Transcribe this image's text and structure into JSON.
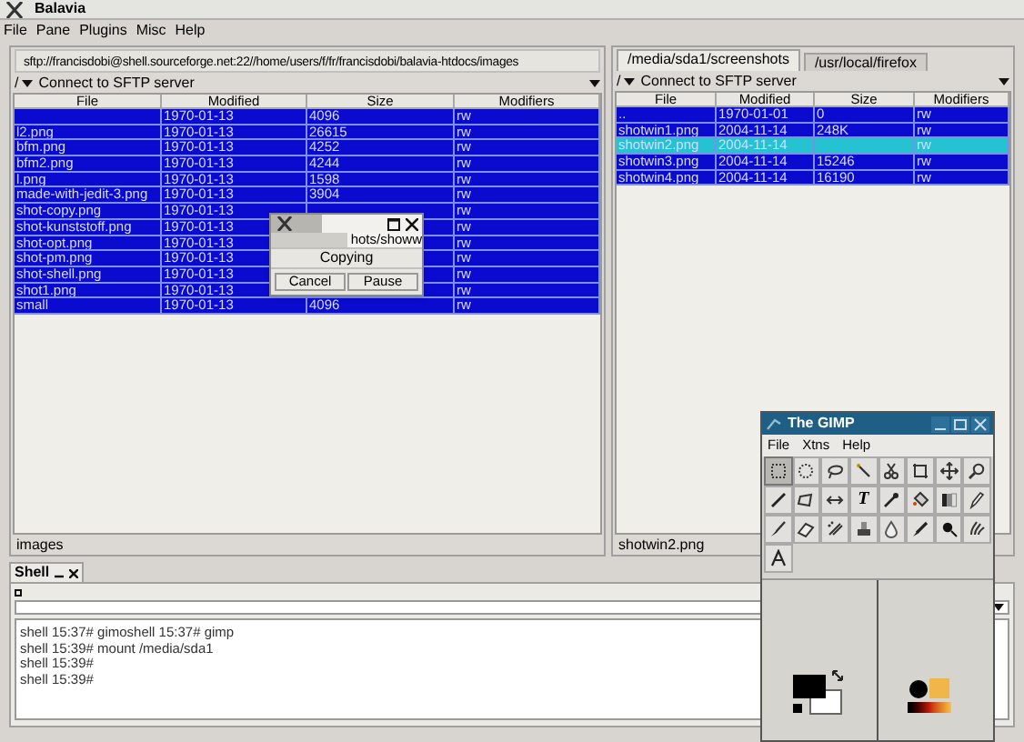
{
  "window": {
    "title": "Balavia"
  },
  "menu": [
    "File",
    "Pane",
    "Plugins",
    "Misc",
    "Help"
  ],
  "left_pane": {
    "path": "sftp://francisdobi@shell.sourceforge.net:22//home/users/f/fr/francisdobi/balavia-htdocs/images",
    "root": "/",
    "connection": "Connect to SFTP server",
    "columns": [
      "File",
      "Modified",
      "Size",
      "Modifiers"
    ],
    "rows": [
      {
        "modified": "1970-01-13",
        "size": "4096",
        "modifiers": "rw",
        "selected": true
      },
      {
        "file": "l2.png",
        "modified": "1970-01-13",
        "size": "26615",
        "modifiers": "rw",
        "selected": true
      },
      {
        "file": "bfm.png",
        "modified": "1970-01-13",
        "size": "4252",
        "modifiers": "rw",
        "selected": true
      },
      {
        "file": "bfm2.png",
        "modified": "1970-01-13",
        "size": "4244",
        "modifiers": "rw",
        "selected": true
      },
      {
        "file": "l.png",
        "modified": "1970-01-13",
        "size": "1598",
        "modifiers": "rw",
        "selected": true
      },
      {
        "file": "made-with-jedit-3.png",
        "modified": "1970-01-13",
        "size": "3904",
        "modifiers": "rw",
        "selected": true
      },
      {
        "file": "shot-copy.png",
        "modified": "1970-01-13",
        "modifiers": "rw",
        "selected": true
      },
      {
        "file": "shot-kunststoff.png",
        "modified": "1970-01-13",
        "modifiers": "rw",
        "selected": true
      },
      {
        "file": "shot-opt.png",
        "modified": "1970-01-13",
        "modifiers": "rw",
        "selected": true
      },
      {
        "file": "shot-pm.png",
        "modified": "1970-01-13",
        "modifiers": "rw",
        "selected": true
      },
      {
        "file": "shot-shell.png",
        "modified": "1970-01-13",
        "modifiers": "rw",
        "selected": true
      },
      {
        "file": "shot1.png",
        "modified": "1970-01-13",
        "modifiers": "rw",
        "selected": true
      },
      {
        "file": "small",
        "modified": "1970-01-13",
        "size": "4096",
        "modifiers": "rw",
        "selected": true
      }
    ],
    "status": "images"
  },
  "right_pane": {
    "tabs": [
      {
        "label": "/media/sda1/screenshots",
        "selected": true
      },
      {
        "label": "/usr/local/firefox",
        "selected": false
      }
    ],
    "root": "/",
    "connection": "Connect to SFTP server",
    "columns": [
      "File",
      "Modified",
      "Size",
      "Modifiers"
    ],
    "rows": [
      {
        "file": "..",
        "modified": "1970-01-01",
        "size": "0",
        "modifiers": "rw",
        "selected": true,
        "focused": false
      },
      {
        "file": "shotwin1.png",
        "modified": "2004-11-14",
        "size": "248K",
        "modifiers": "rw",
        "selected": true,
        "focused": false
      },
      {
        "file": "shotwin2.png",
        "modified": "2004-11-14",
        "modifiers": "rw",
        "selected": true,
        "focused": true
      },
      {
        "file": "shotwin3.png",
        "modified": "2004-11-14",
        "size": "15246",
        "modifiers": "rw",
        "selected": true,
        "focused": false
      },
      {
        "file": "shotwin4.png",
        "modified": "2004-11-14",
        "size": "16190",
        "modifiers": "rw",
        "selected": true,
        "focused": false
      }
    ],
    "status": "shotwin2.png"
  },
  "copy_dialog": {
    "field": "hots/showw",
    "label": "Copying",
    "buttons": [
      "Cancel",
      "Pause"
    ]
  },
  "shell": {
    "tab": "Shell",
    "lines": [
      "shell 15:37# gimoshell 15:37# gimp",
      "shell 15:39# mount /media/sda1",
      "shell 15:39#",
      "shell 15:39#"
    ]
  },
  "gimp": {
    "title": "The GIMP",
    "menu": [
      "File",
      "Xtns",
      "Help"
    ],
    "tools": [
      {
        "kind": "rect-select",
        "selected": true
      },
      {
        "kind": "ellipse-select",
        "selected": false
      },
      {
        "kind": "lasso",
        "selected": false
      },
      {
        "kind": "wand",
        "selected": false
      },
      {
        "kind": "scissors",
        "selected": false
      },
      {
        "kind": "crop",
        "selected": false
      },
      {
        "kind": "move",
        "selected": false
      },
      {
        "kind": "magnify",
        "selected": false
      },
      {
        "kind": "line",
        "selected": false
      },
      {
        "kind": "transform",
        "selected": false
      },
      {
        "kind": "flip",
        "selected": false
      },
      {
        "kind": "text",
        "label": "T",
        "selected": false
      },
      {
        "kind": "picker",
        "selected": false
      },
      {
        "kind": "bucket",
        "selected": false
      },
      {
        "kind": "blend",
        "selected": false
      },
      {
        "kind": "pencil",
        "selected": false
      },
      {
        "kind": "brush",
        "selected": false
      },
      {
        "kind": "eraser",
        "selected": false
      },
      {
        "kind": "airbrush",
        "selected": false
      },
      {
        "kind": "clone",
        "selected": false
      },
      {
        "kind": "blur",
        "selected": false
      },
      {
        "kind": "ink",
        "selected": false
      },
      {
        "kind": "dodge",
        "selected": false
      },
      {
        "kind": "smudge",
        "selected": false
      },
      {
        "kind": "measure",
        "selected": false
      }
    ]
  }
}
